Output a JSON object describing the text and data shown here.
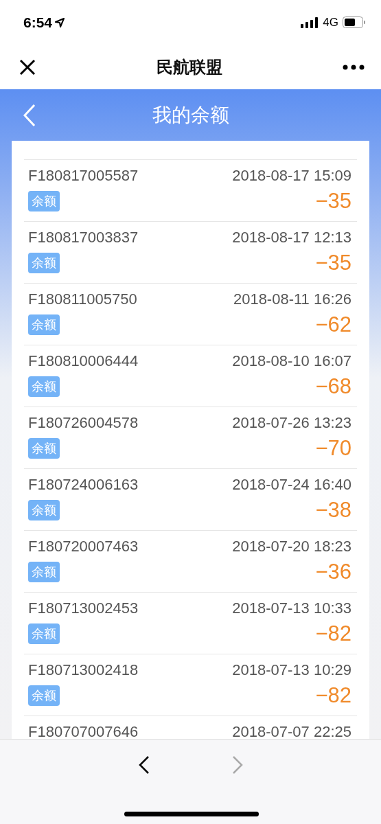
{
  "status_bar": {
    "time": "6:54",
    "network": "4G"
  },
  "nav_bar": {
    "title": "民航联盟"
  },
  "header": {
    "title": "我的余额"
  },
  "records": [
    {
      "order": "F180817005587",
      "time": "2018-08-17 15:09",
      "tag": "余额",
      "amount": "−35"
    },
    {
      "order": "F180817003837",
      "time": "2018-08-17 12:13",
      "tag": "余额",
      "amount": "−35"
    },
    {
      "order": "F180811005750",
      "time": "2018-08-11 16:26",
      "tag": "余额",
      "amount": "−62"
    },
    {
      "order": "F180810006444",
      "time": "2018-08-10 16:07",
      "tag": "余额",
      "amount": "−68"
    },
    {
      "order": "F180726004578",
      "time": "2018-07-26 13:23",
      "tag": "余额",
      "amount": "−70"
    },
    {
      "order": "F180724006163",
      "time": "2018-07-24 16:40",
      "tag": "余额",
      "amount": "−38"
    },
    {
      "order": "F180720007463",
      "time": "2018-07-20 18:23",
      "tag": "余额",
      "amount": "−36"
    },
    {
      "order": "F180713002453",
      "time": "2018-07-13 10:33",
      "tag": "余额",
      "amount": "−82"
    },
    {
      "order": "F180713002418",
      "time": "2018-07-13 10:29",
      "tag": "余额",
      "amount": "−82"
    },
    {
      "order": "F180707007646",
      "time": "2018-07-07 22:25"
    }
  ],
  "toolbar": {
    "back": {
      "disabled": false
    },
    "forward": {
      "disabled": true
    }
  }
}
